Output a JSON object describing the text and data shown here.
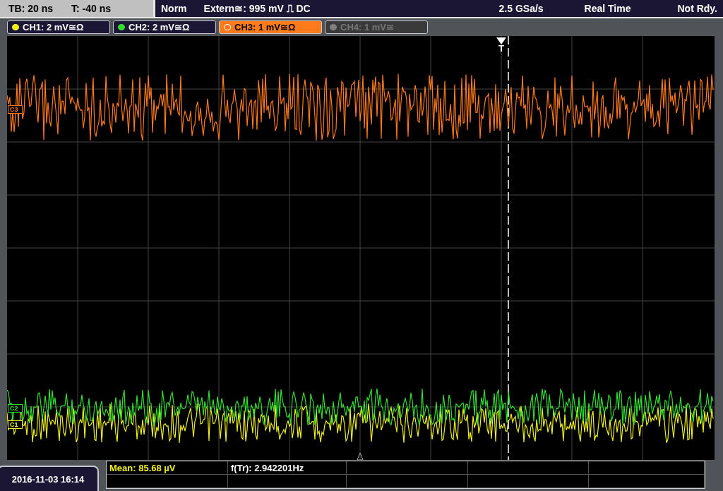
{
  "status_bar": {
    "timebase": "TB: 20 ns",
    "trigger_time": "T: -40 ns",
    "trigger_mode": "Norm",
    "trigger_source": "Extern≅: 995 mV ⎍ DC",
    "sample_rate": "2.5 GSa/s",
    "acquisition": "Real Time",
    "status": "Not Rdy."
  },
  "channels": [
    {
      "label": "CH1: 2 mV≅Ω",
      "color": "#f0f020",
      "selected": false,
      "enabled": true
    },
    {
      "label": "CH2: 2 mV≅Ω",
      "color": "#30e030",
      "selected": false,
      "enabled": true
    },
    {
      "label": "CH3: 1 mV≅Ω",
      "color": "#ff7a1a",
      "selected": true,
      "enabled": true
    },
    {
      "label": "CH4: 1 mV≅",
      "color": "#808080",
      "selected": false,
      "enabled": false
    }
  ],
  "trace_markers": [
    {
      "label": "C3",
      "color": "#ff7a1a"
    },
    {
      "label": "C2",
      "color": "#30e030"
    },
    {
      "label": "C1",
      "color": "#f0f020"
    }
  ],
  "trigger_marker": "T",
  "measurements": [
    {
      "text": "Mean: 85.68 µV",
      "kind": "channel"
    },
    {
      "text": "f(Tr): 2.942201Hz",
      "kind": "trigger"
    }
  ],
  "date": "2016-11-03 16:14"
}
